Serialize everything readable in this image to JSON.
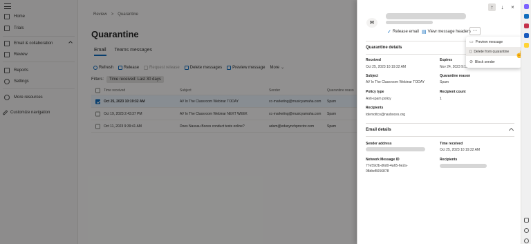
{
  "nav": {
    "items": [
      {
        "label": "Home",
        "icon": "home-icon"
      },
      {
        "label": "Trials",
        "icon": "trials-icon"
      },
      {
        "label": "Email & collaboration",
        "icon": "email-icon"
      },
      {
        "label": "Review",
        "icon": "review-icon"
      },
      {
        "label": "Reports",
        "icon": "reports-icon"
      },
      {
        "label": "Settings",
        "icon": "gear-icon"
      },
      {
        "label": "More resources",
        "icon": "info-icon"
      },
      {
        "label": "Customize navigation",
        "icon": "pencil-icon"
      }
    ]
  },
  "breadcrumb": {
    "part1": "Review",
    "sep": ">",
    "part2": "Quarantine"
  },
  "page": {
    "title": "Quarantine"
  },
  "tabs": [
    {
      "label": "Email"
    },
    {
      "label": "Teams messages"
    }
  ],
  "toolbar": {
    "refresh": "Refresh",
    "release": "Release",
    "request_release": "Request release",
    "delete": "Delete messages",
    "preview": "Preview message",
    "more": "More",
    "more_icon": "⌄"
  },
  "filters": {
    "label": "Filters:",
    "chip": "Time received: Last 30 days"
  },
  "grid": {
    "headers": {
      "time": "Time received",
      "subject": "Subject",
      "sender": "Sender",
      "reason": "Quarantine reaso"
    },
    "rows": [
      {
        "time": "Oct 25, 2023 10:19:32 AM",
        "subject": "AV In The Classroom Webinar TODAY",
        "sender": "cc-marketing@musicyamaha.com",
        "reason": "Spam"
      },
      {
        "time": "Oct 19, 2023 2:43:37 PM",
        "subject": "AV In The Classroom Webinar NEXT WEEK",
        "sender": "cc-marketing@musicyamaha.com",
        "reason": "Spam"
      },
      {
        "time": "Oct 11, 2023 9:39:41 AM",
        "subject": "Does Nassau Boces conduct tests online?",
        "sender": "adam@edusynchproctor.com",
        "reason": "Spam"
      }
    ]
  },
  "panel": {
    "envelope_icon": "✉",
    "actions": {
      "release": "Release email",
      "headers": "View message headers",
      "more": "···"
    },
    "nav": {
      "up": "↑",
      "down": "↓",
      "close": "×"
    },
    "quarantine": {
      "title": "Quarantine details",
      "received_label": "Received",
      "received_value": "Oct 25, 2023 10:19:32 AM",
      "expires_label": "Expires",
      "expires_value": "Nov 24, 2023 9:19:32 AM",
      "subject_label": "Subject",
      "subject_value": "AV In The Classroom Webinar TODAY",
      "reason_label": "Quarantine reason",
      "reason_value": "Spam",
      "policy_label": "Policy type",
      "policy_value": "Anti-spam policy",
      "count_label": "Recipient count",
      "count_value": "1",
      "recipients_label": "Recipients",
      "recipients_value": "tdemottco@nasboces.org"
    },
    "email": {
      "title": "Email details",
      "sender_label": "Sender address",
      "time_label": "Time received",
      "time_value": "Oct 25, 2023 10:19:32 AM",
      "netid_label": "Network Message ID",
      "netid_line1": "77e59cfb-d6d0-4a65-6e2a-",
      "netid_line2": "08dbd5656878",
      "recipients_label": "Recipients"
    }
  },
  "menu": {
    "items": [
      {
        "label": "Preview message",
        "icon": "preview-icon"
      },
      {
        "label": "Delete from quarantine",
        "icon": "trash-icon"
      },
      {
        "label": "Block sender",
        "icon": "block-icon"
      }
    ]
  },
  "colors": {
    "accent": "#0f6cbd",
    "overlay": "#00000066"
  }
}
